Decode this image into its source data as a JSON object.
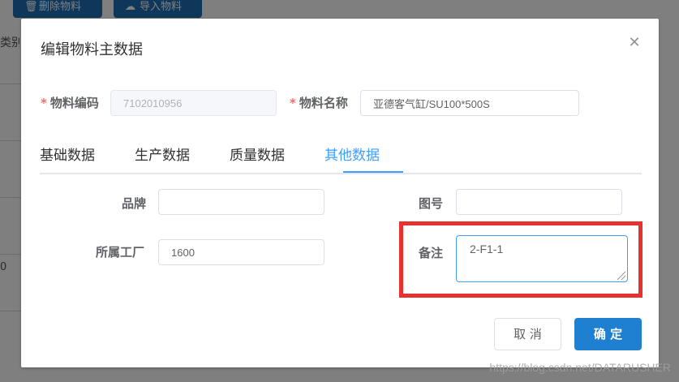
{
  "background": {
    "delete_button": "删除物料",
    "import_button": "导入物料",
    "column_header": "类别",
    "row_value": "0"
  },
  "dialog": {
    "title": "编辑物料主数据",
    "material_code": {
      "label": "物料编码",
      "value": "7102010956"
    },
    "material_name": {
      "label": "物料名称",
      "value": "亚德客气缸/SU100*500S"
    },
    "tabs": [
      {
        "label": "基础数据",
        "active": false
      },
      {
        "label": "生产数据",
        "active": false
      },
      {
        "label": "质量数据",
        "active": false
      },
      {
        "label": "其他数据",
        "active": true
      }
    ],
    "brand": {
      "label": "品牌",
      "value": ""
    },
    "drawing_no": {
      "label": "图号",
      "value": ""
    },
    "factory": {
      "label": "所属工厂",
      "value": "1600"
    },
    "remark": {
      "label": "备注",
      "value": "2-F1-1"
    },
    "cancel_label": "取 消",
    "confirm_label": "确 定"
  },
  "watermark": "https://blog.csdn.net/DATARUSHER",
  "colors": {
    "primary": "#409eff",
    "highlight": "#e8302e",
    "required": "#f56c6c"
  }
}
